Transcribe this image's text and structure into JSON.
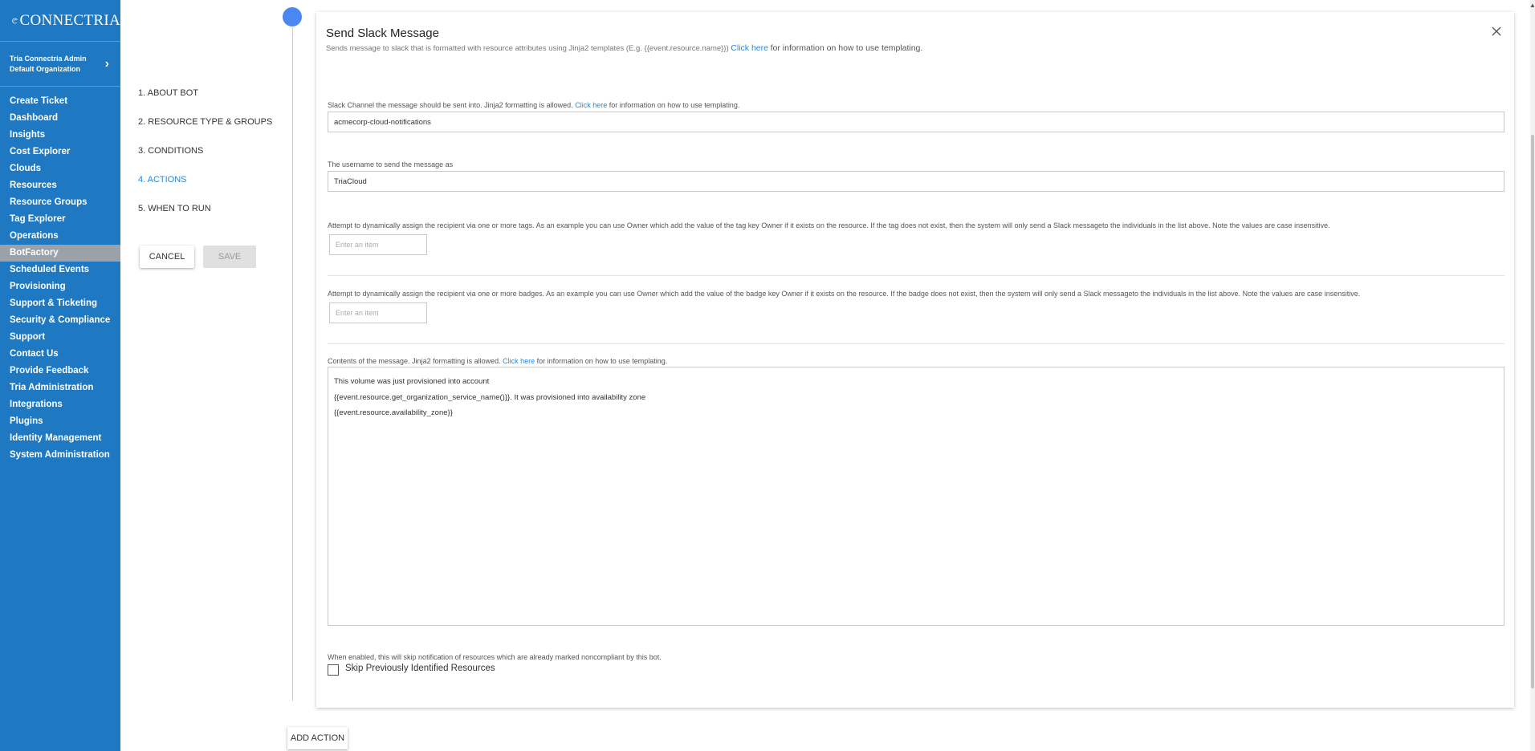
{
  "app": {
    "brand": "CONNECTRIA",
    "user_name": "Tria Connectria Admin",
    "organization": "Default Organization"
  },
  "sidebar": {
    "items": [
      {
        "label": "Create Ticket"
      },
      {
        "label": "Dashboard"
      },
      {
        "label": "Insights"
      },
      {
        "label": "Cost Explorer"
      },
      {
        "label": "Clouds"
      },
      {
        "label": "Resources"
      },
      {
        "label": "Resource Groups"
      },
      {
        "label": "Tag Explorer"
      },
      {
        "label": "Operations"
      },
      {
        "label": "BotFactory",
        "active": true
      },
      {
        "label": "Scheduled Events"
      },
      {
        "label": "Provisioning"
      },
      {
        "label": "Support & Ticketing"
      },
      {
        "label": "Security & Compliance"
      },
      {
        "label": "Support"
      },
      {
        "label": "Contact Us"
      },
      {
        "label": "Provide Feedback"
      },
      {
        "label": "Tria Administration"
      },
      {
        "label": "Integrations"
      },
      {
        "label": "Plugins"
      },
      {
        "label": "Identity Management"
      },
      {
        "label": "System Administration"
      }
    ]
  },
  "steps": {
    "items": [
      {
        "label": "1. ABOUT BOT"
      },
      {
        "label": "2. RESOURCE TYPE & GROUPS"
      },
      {
        "label": "3. CONDITIONS"
      },
      {
        "label": "4. ACTIONS",
        "active": true
      },
      {
        "label": "5. WHEN TO RUN"
      }
    ],
    "cancel_label": "CANCEL",
    "save_label": "SAVE"
  },
  "action": {
    "title": "Send Slack Message",
    "description": "Sends message to slack that is formatted with resource attributes using Jinja2 templates (E.g. {{event.resource.name}})",
    "click_here": "Click here",
    "desc_suffix": "for information on how to use templating.",
    "channel": {
      "label": "Slack Channel the message should be sent into. Jinja2 formatting is allowed.",
      "link": "Click here",
      "label_suffix": "for information on how to use templating.",
      "value": "acmecorp-cloud-notifications"
    },
    "username": {
      "label": "The username to send the message as",
      "value": "TriaCloud"
    },
    "tags": {
      "label": "Attempt to dynamically assign the recipient via one or more tags. As an example you can use Owner which add the value of the tag key Owner if it exists on the resource. If the tag does not exist, then the system will only send a Slack messageto the individuals in the list above. Note the values are case insensitive.",
      "placeholder": "Enter an item"
    },
    "badges": {
      "label": "Attempt to dynamically assign the recipient via one or more badges. As an example you can use Owner which add the value of the badge key Owner if it exists on the resource. If the badge does not exist, then the system will only send a Slack messageto the individuals in the list above. Note the values are case insensitive.",
      "placeholder": "Enter an item"
    },
    "contents": {
      "label": "Contents of the message. Jinja2 formatting is allowed.",
      "link": "Click here",
      "label_suffix": "for information on how to use templating.",
      "lines": [
        "This volume was just provisioned into account",
        "{{event.resource.get_organization_service_name()}}. It was provisioned into availability zone",
        "{{event.resource.availability_zone}}"
      ]
    },
    "skip": {
      "help": "When enabled, this will skip notification of resources which are already marked noncompliant by this bot.",
      "label": "Skip Previously Identified Resources",
      "checked": false
    }
  },
  "add_action_label": "ADD ACTION",
  "colors": {
    "sidebar": "#1e78c2",
    "active_nav": "#9aa1a8",
    "accent": "#2a88d8",
    "timeline_dot": "#4a87f0"
  }
}
